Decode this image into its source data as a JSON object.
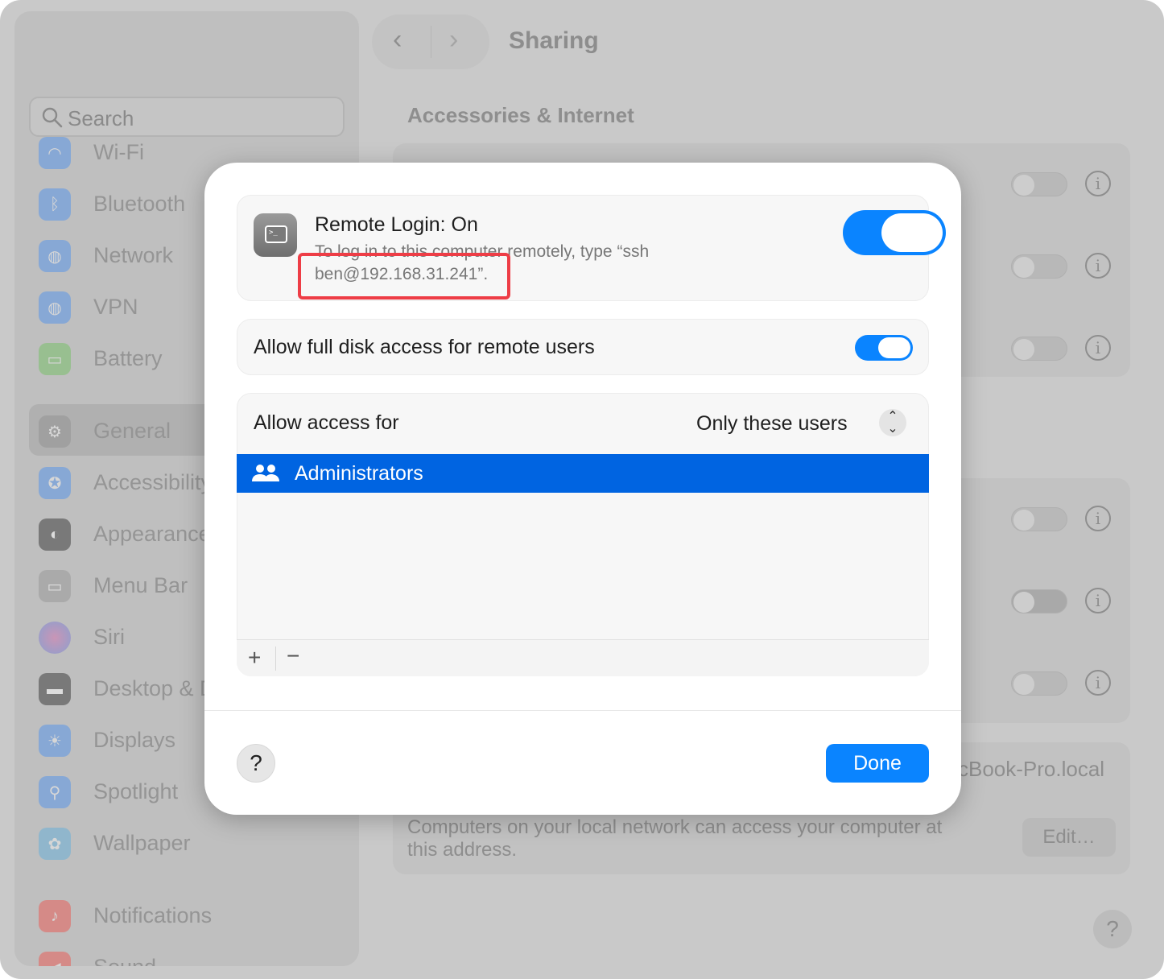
{
  "window": {
    "title": "Sharing"
  },
  "sidebar": {
    "search_placeholder": "Search",
    "items_top": [
      {
        "label": "Wi-Fi",
        "icon": "wifi-icon",
        "color": "#5a96e8"
      },
      {
        "label": "Bluetooth",
        "icon": "bluetooth-icon",
        "color": "#5a96e8"
      },
      {
        "label": "Network",
        "icon": "globe-icon",
        "color": "#5a96e8"
      },
      {
        "label": "VPN",
        "icon": "vpn-globe-icon",
        "color": "#5a96e8"
      },
      {
        "label": "Battery",
        "icon": "battery-icon",
        "color": "#7ac06a"
      }
    ],
    "items_mid": [
      {
        "label": "General",
        "icon": "gear-icon",
        "color": "#9a9a9a"
      },
      {
        "label": "Accessibility",
        "icon": "accessibility-icon",
        "color": "#5a96e8"
      },
      {
        "label": "Appearance",
        "icon": "appearance-icon",
        "color": "#5c5c5c"
      },
      {
        "label": "Menu Bar",
        "icon": "menubar-icon",
        "color": "#a2a2a2"
      },
      {
        "label": "Siri",
        "icon": "siri-icon",
        "color": "#b07ad0"
      },
      {
        "label": "Desktop & Dock",
        "icon": "dock-icon",
        "color": "#5c5c5c"
      },
      {
        "label": "Displays",
        "icon": "sun-icon",
        "color": "#5a96e8"
      },
      {
        "label": "Spotlight",
        "icon": "magnifier-icon",
        "color": "#5a96e8"
      },
      {
        "label": "Wallpaper",
        "icon": "flower-icon",
        "color": "#6ab0d8"
      }
    ],
    "items_bottom": [
      {
        "label": "Notifications",
        "icon": "bell-icon",
        "color": "#e8605a"
      },
      {
        "label": "Sound",
        "icon": "speaker-icon",
        "color": "#e8605a"
      }
    ]
  },
  "background": {
    "section_title": "Accessories & Internet",
    "hostname_fragment": "cBook-Pro.local",
    "address_note": "Computers on your local network can access your computer at this address.",
    "edit_label": "Edit…",
    "help_label": "?"
  },
  "modal": {
    "remote_login_title": "Remote Login: On",
    "remote_login_desc_line1": "To log in to this computer remotely, type “ssh",
    "remote_login_desc_line2": "ben@192.168.31.241”.",
    "remote_login_enabled": true,
    "full_disk_label": "Allow full disk access for remote users",
    "full_disk_enabled": true,
    "access_label": "Allow access for",
    "access_value": "Only these users",
    "users": [
      "Administrators"
    ],
    "add_label": "+",
    "remove_label": "−",
    "help_label": "?",
    "done_label": "Done"
  },
  "colors": {
    "accent": "#0a84ff",
    "selection": "#0064e1",
    "highlight_box": "#ee3d46"
  }
}
